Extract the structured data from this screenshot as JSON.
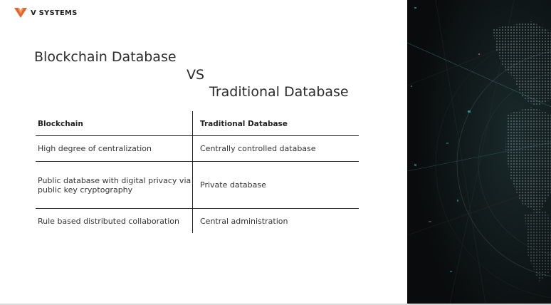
{
  "logo": {
    "text": "V SYSTEMS",
    "mark_color": "#e8632b"
  },
  "title": {
    "line1": "Blockchain Database",
    "line2": "VS",
    "line3": "Traditional Database"
  },
  "table": {
    "headers": [
      "Blockchain",
      "Traditional Database"
    ],
    "rows": [
      [
        "High degree of centralization",
        "Centrally controlled database"
      ],
      [
        "Public database with digital privacy via public key cryptography",
        "Private database"
      ],
      [
        "Rule based distributed collaboration",
        "Central administration"
      ]
    ]
  },
  "image": {
    "icon": "digital-globe-image",
    "accent": "#2fa3a6"
  }
}
